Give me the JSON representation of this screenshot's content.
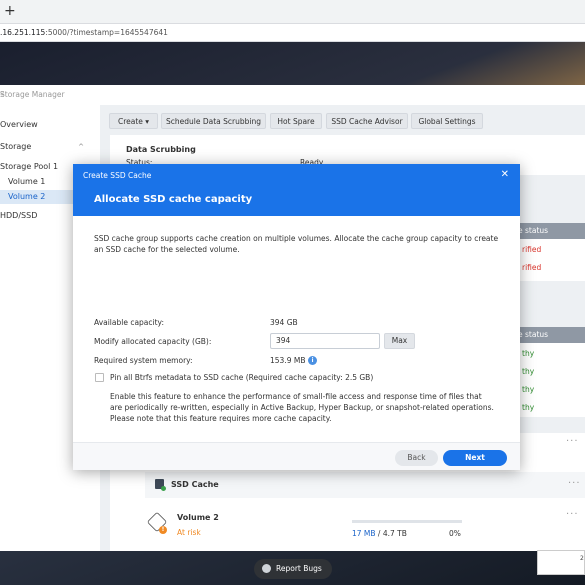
{
  "browser": {
    "new_tab_glyph": "+",
    "url_host": ".16.251.115",
    "url_rest": ":5000/?timestamp=1645547641"
  },
  "window": {
    "title": "Storage Manager",
    "help_glyph": "?",
    "minimize_glyph": "–"
  },
  "sidebar": {
    "items": [
      {
        "label": "Overview"
      },
      {
        "label": "Storage",
        "chevron": "^"
      },
      {
        "label": "Storage Pool 1"
      },
      {
        "label": "Volume 1"
      },
      {
        "label": "Volume 2"
      },
      {
        "label": "HDD/SSD"
      }
    ]
  },
  "toolbar": {
    "create": "Create ▾",
    "schedule": "Schedule Data Scrubbing",
    "hot_spare": "Hot Spare",
    "advisor": "SSD Cache Advisor",
    "global": "Global Settings"
  },
  "scrubbing": {
    "title": "Data Scrubbing",
    "status_label": "Status:",
    "status_value": "Ready"
  },
  "status_table_1": {
    "header": "e status",
    "rows": [
      "rified",
      "rified"
    ]
  },
  "status_table_2": {
    "header": "e status",
    "rows": [
      "thy",
      "thy",
      "thy",
      "thy"
    ]
  },
  "pool_card": {
    "more": "···",
    "ssd_cache": "SSD Cache",
    "volume_name": "Volume 2",
    "volume_status": "At risk",
    "used": "17 MB",
    "total": " / 4.7 TB",
    "percent": "0%",
    "fill_fraction": 0.0
  },
  "modal": {
    "app_title": "Create SSD Cache",
    "close_glyph": "✕",
    "title": "Allocate SSD cache capacity",
    "description": "SSD cache group supports cache creation on multiple volumes. Allocate the cache group capacity to create an SSD cache for the selected volume.",
    "available_label": "Available capacity:",
    "available_value": "394 GB",
    "modify_label": "Modify allocated capacity (GB):",
    "modify_value": "394",
    "max_button": "Max",
    "memory_label": "Required system memory:",
    "memory_value": "153.9 MB",
    "info_glyph": "i",
    "pin_label": "Pin all Btrfs metadata to SSD cache (Required cache capacity: 2.5 GB)",
    "pin_note": "Enable this feature to enhance the performance of small-file access and response time of files that are periodically re-written, especially in Active Backup, Hyper Backup, or snapshot-related operations. Please note that this feature requires more cache capacity.",
    "back": "Back",
    "next": "Next"
  },
  "footer": {
    "report_bugs": "Report Bugs",
    "corner_value": "2"
  },
  "colors": {
    "accent": "#1a73e8",
    "warning": "#f08a24",
    "error": "#d9342b",
    "healthy": "#2e8b2e"
  }
}
